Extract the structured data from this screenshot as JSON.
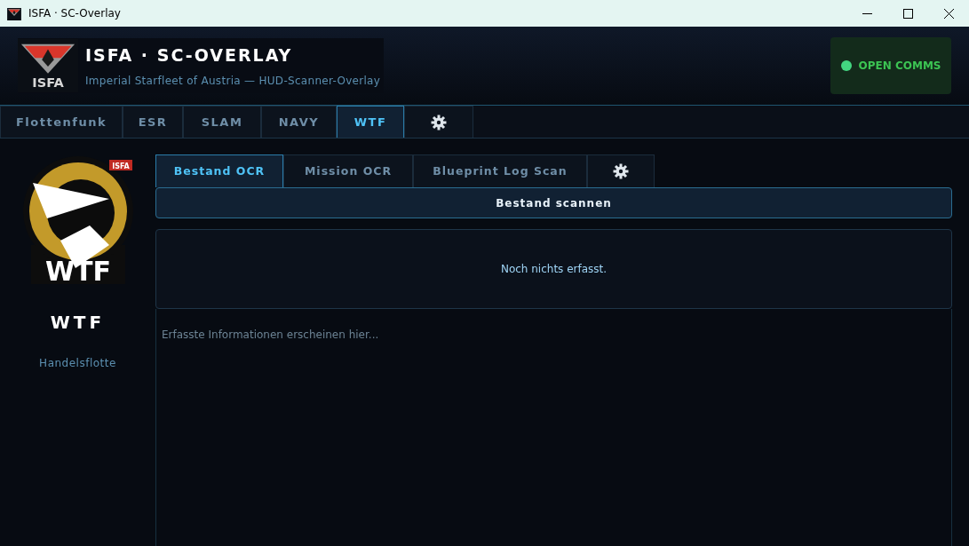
{
  "window": {
    "title": "ISFA · SC-Overlay"
  },
  "header": {
    "logo_text": "ISFA",
    "title": "ISFA · SC-OVERLAY",
    "subtitle": "Imperial Starfleet of Austria — HUD-Scanner-Overlay",
    "comms": {
      "label": "OPEN COMMS",
      "online": true
    }
  },
  "tabs": [
    {
      "kind": "text",
      "label": "Flottenfunk",
      "selected": false
    },
    {
      "kind": "text",
      "label": "ESR",
      "selected": false
    },
    {
      "kind": "text",
      "label": "SLAM",
      "selected": false
    },
    {
      "kind": "text",
      "label": "NAVY",
      "selected": false
    },
    {
      "kind": "text",
      "label": "WTF",
      "selected": true
    },
    {
      "kind": "settings",
      "selected": false
    }
  ],
  "sidebar": {
    "badge_text": "WTF",
    "badge_tag": "ISFA",
    "name": "WTF",
    "subtitle": "Handelsflotte"
  },
  "subtabs": [
    {
      "kind": "text",
      "label": "Bestand OCR",
      "selected": true
    },
    {
      "kind": "text",
      "label": "Mission OCR",
      "selected": false
    },
    {
      "kind": "text",
      "label": "Blueprint Log Scan",
      "selected": false
    },
    {
      "kind": "settings",
      "selected": false
    }
  ],
  "scan_button": "Bestand scannen",
  "result": "Noch nichts erfasst.",
  "output": {
    "placeholder": "Erfasste Informationen erscheinen hier..."
  }
}
